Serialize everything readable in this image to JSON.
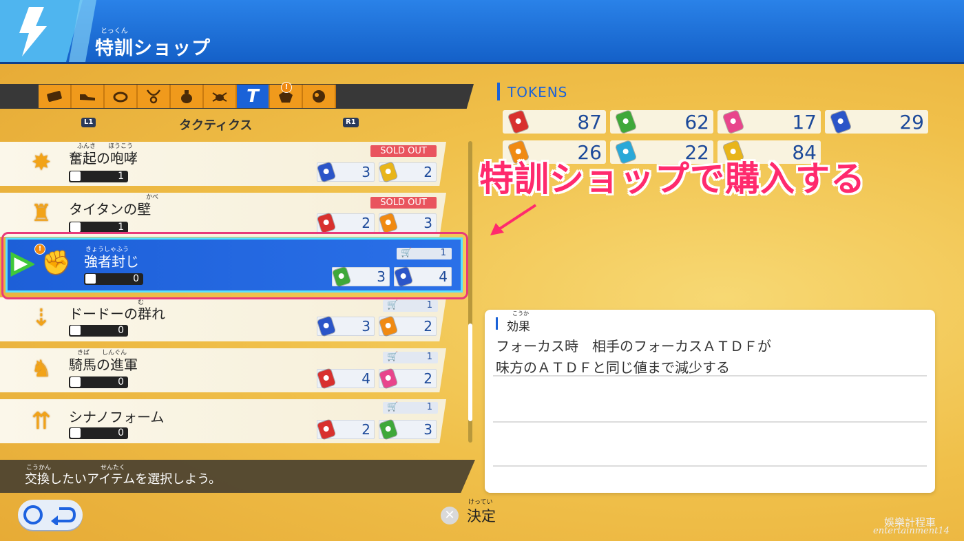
{
  "header": {
    "title": "特訓ショップ",
    "title_ruby": "とっくん"
  },
  "tabs": {
    "items": [
      {
        "icon": "ticket-icon",
        "active": false
      },
      {
        "icon": "shoe-icon",
        "active": false
      },
      {
        "icon": "ring-icon",
        "active": false
      },
      {
        "icon": "necklace-icon",
        "active": false
      },
      {
        "icon": "bag-icon",
        "active": false
      },
      {
        "icon": "bug-icon",
        "active": false
      },
      {
        "icon": "tactics-t-icon",
        "active": true,
        "label": "T"
      },
      {
        "icon": "pentagon-icon",
        "active": false
      },
      {
        "icon": "ball-icon",
        "active": false
      }
    ],
    "badge": "!",
    "left_hint": "L1",
    "right_hint": "R1",
    "category_label": "タクティクス"
  },
  "items": [
    {
      "name": "奮起の咆哮",
      "ruby": "ふんき　　ほうこう",
      "owned": "1",
      "status": "SOLD OUT",
      "prices": [
        {
          "color": "#2b55c8",
          "value": "3"
        },
        {
          "color": "#e8b51a",
          "value": "2"
        }
      ]
    },
    {
      "name": "タイタンの壁",
      "ruby": "かべ",
      "owned": "1",
      "status": "SOLD OUT",
      "prices": [
        {
          "color": "#d8302e",
          "value": "2"
        },
        {
          "color": "#f08a12",
          "value": "3"
        }
      ]
    },
    {
      "name": "強者封じ",
      "ruby": "きょうしゃふう",
      "owned": "0",
      "stock": "1",
      "selected": true,
      "prices": [
        {
          "color": "#3fa83a",
          "value": "3"
        },
        {
          "color": "#2b55c8",
          "value": "4"
        }
      ]
    },
    {
      "name": "ドードーの群れ",
      "ruby": "む",
      "owned": "0",
      "stock": "1",
      "prices": [
        {
          "color": "#2b55c8",
          "value": "3"
        },
        {
          "color": "#f08a12",
          "value": "2"
        }
      ]
    },
    {
      "name": "騎馬の進軍",
      "ruby": "きば　　しんぐん",
      "owned": "0",
      "stock": "1",
      "prices": [
        {
          "color": "#d8302e",
          "value": "4"
        },
        {
          "color": "#e8458c",
          "value": "2"
        }
      ]
    },
    {
      "name": "シナノフォーム",
      "ruby": "",
      "owned": "0",
      "stock": "1",
      "prices": [
        {
          "color": "#d8302e",
          "value": "2"
        },
        {
          "color": "#3fa83a",
          "value": "3"
        }
      ]
    }
  ],
  "hint": {
    "text": "交換したいアイテムを選択しよう。",
    "ruby": "こうかん　　　　　　　　せんたく"
  },
  "footer": {
    "confirm_label": "決定",
    "confirm_ruby": "けってい"
  },
  "tokens": {
    "label": "TOKENS",
    "values": [
      {
        "color": "#d8302e",
        "value": "87"
      },
      {
        "color": "#3fa83a",
        "value": "62"
      },
      {
        "color": "#e8458c",
        "value": "17"
      },
      {
        "color": "#2b55c8",
        "value": "29"
      },
      {
        "color": "#f08a12",
        "value": "26"
      },
      {
        "color": "#2aa8d8",
        "value": "22"
      },
      {
        "color": "#e8b51a",
        "value": "84"
      }
    ]
  },
  "annotation": "特訓ショップで購入する",
  "effect": {
    "title": "効果",
    "title_ruby": "こうか",
    "line1": "フォーカス時　相手のフォーカスＡＴＤＦが",
    "line2": "味方のＡＴＤＦと同じ値まで減少する"
  },
  "watermark": {
    "line1": "娛樂計程車",
    "line2": "entertainment14"
  }
}
